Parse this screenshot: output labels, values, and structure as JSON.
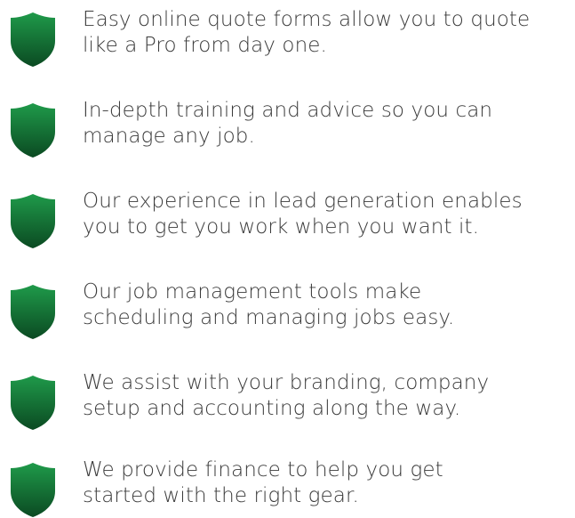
{
  "colors": {
    "shield_top": "#1f9a4a",
    "shield_bottom": "#0b4a22",
    "text": "#3a3a3a"
  },
  "features": [
    {
      "icon": "shield-icon",
      "line1": "Easy online quote forms allow you to quote",
      "line2": "like a Pro from day one."
    },
    {
      "icon": "shield-icon",
      "line1": "In-depth training and advice so you can",
      "line2": "manage any job."
    },
    {
      "icon": "shield-icon",
      "line1": "Our experience in lead generation enables",
      "line2": "you to get you work when you want it."
    },
    {
      "icon": "shield-icon",
      "line1": "Our job management tools make",
      "line2": "scheduling and managing jobs easy."
    },
    {
      "icon": "shield-icon",
      "line1": "We assist with your branding, company",
      "line2": "setup and accounting along the way."
    },
    {
      "icon": "shield-icon",
      "line1": "We provide finance to help you get",
      "line2": "started with the right gear."
    }
  ]
}
